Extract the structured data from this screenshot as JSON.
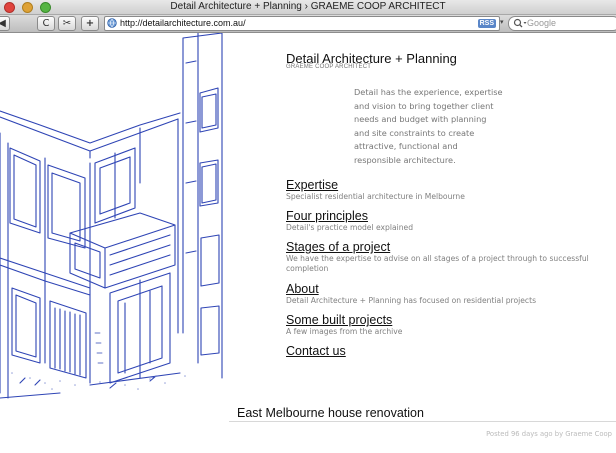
{
  "window": {
    "title": "Detail Architecture + Planning › GRAEME COOP ARCHITECT"
  },
  "toolbar": {
    "back_icon": "◀",
    "reload_icon": "C",
    "stop_icon": "✂",
    "add_icon": "+",
    "url": "http://detailarchitecture.com.au/",
    "rss_label": "RSS",
    "search_placeholder": "Google"
  },
  "site": {
    "title": "Detail Architecture + Planning",
    "subtitle": "GRAEME COOP ARCHITECT",
    "intro": "Detail has the experience, expertise and vision to bring together client needs and budget with planning and site constraints to create attractive, functional and responsible architecture."
  },
  "nav": [
    {
      "label": "Expertise",
      "desc": "Specialist residential architecture in Melbourne"
    },
    {
      "label": "Four principles",
      "desc": "Detail's practice model explained"
    },
    {
      "label": "Stages of a project",
      "desc": "We have the expertise to advise on all stages of a project through to successful completion"
    },
    {
      "label": "About",
      "desc": "Detail Architecture + Planning has focused on residential projects"
    },
    {
      "label": "Some built projects",
      "desc": "A few images from the archive"
    },
    {
      "label": "Contact us",
      "desc": ""
    }
  ],
  "post": {
    "title": "East Melbourne house renovation",
    "meta": "Posted 96 days ago by Graeme Coop"
  },
  "colors": {
    "sketch_ink": "#2f45b5",
    "text": "#111111",
    "muted": "#808080"
  },
  "icons": [
    "close-icon",
    "minimize-icon",
    "maximize-icon",
    "back-icon",
    "reload-icon",
    "scissors-icon",
    "add-icon",
    "globe-icon",
    "search-icon"
  ]
}
